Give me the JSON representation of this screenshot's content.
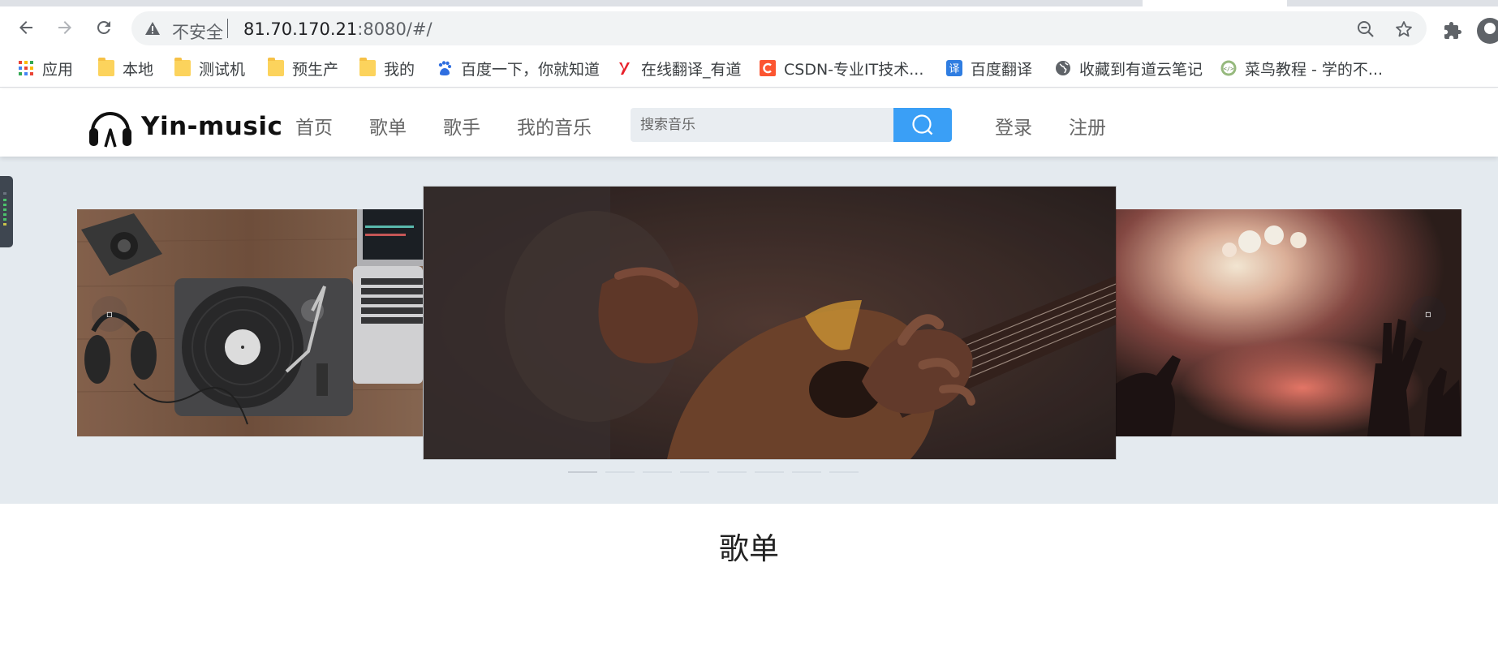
{
  "browser": {
    "security_label": "不安全",
    "url_host": "81.70.170.21",
    "url_rest": ":8080/#/"
  },
  "bookmarks": [
    {
      "label": "应用",
      "icon": "apps-grid-icon"
    },
    {
      "label": "本地",
      "icon": "folder-icon"
    },
    {
      "label": "测试机",
      "icon": "folder-icon"
    },
    {
      "label": "预生产",
      "icon": "folder-icon"
    },
    {
      "label": "我的",
      "icon": "folder-icon"
    },
    {
      "label": "百度一下，你就知道",
      "icon": "baidu-paw-icon"
    },
    {
      "label": "在线翻译_有道",
      "icon": "youdao-icon"
    },
    {
      "label": "CSDN-专业IT技术...",
      "icon": "csdn-icon"
    },
    {
      "label": "百度翻译",
      "icon": "baidu-translate-icon"
    },
    {
      "label": "收藏到有道云笔记",
      "icon": "globe-icon"
    },
    {
      "label": "菜鸟教程 - 学的不...",
      "icon": "runoob-icon"
    }
  ],
  "site": {
    "brand": "Yin-music",
    "nav": [
      "首页",
      "歌单",
      "歌手",
      "我的音乐"
    ],
    "search_placeholder": "搜索音乐",
    "login": "登录",
    "register": "注册"
  },
  "carousel": {
    "slides": [
      "turntable-desk-image",
      "guitar-hands-image",
      "concert-lights-image"
    ],
    "indicator_count": 8,
    "active_index": 0
  },
  "section": {
    "title": "歌单"
  },
  "colors": {
    "accent_blue": "#3a9ff6",
    "carousel_bg": "#e4eaef",
    "search_bg": "#e9edf1"
  }
}
